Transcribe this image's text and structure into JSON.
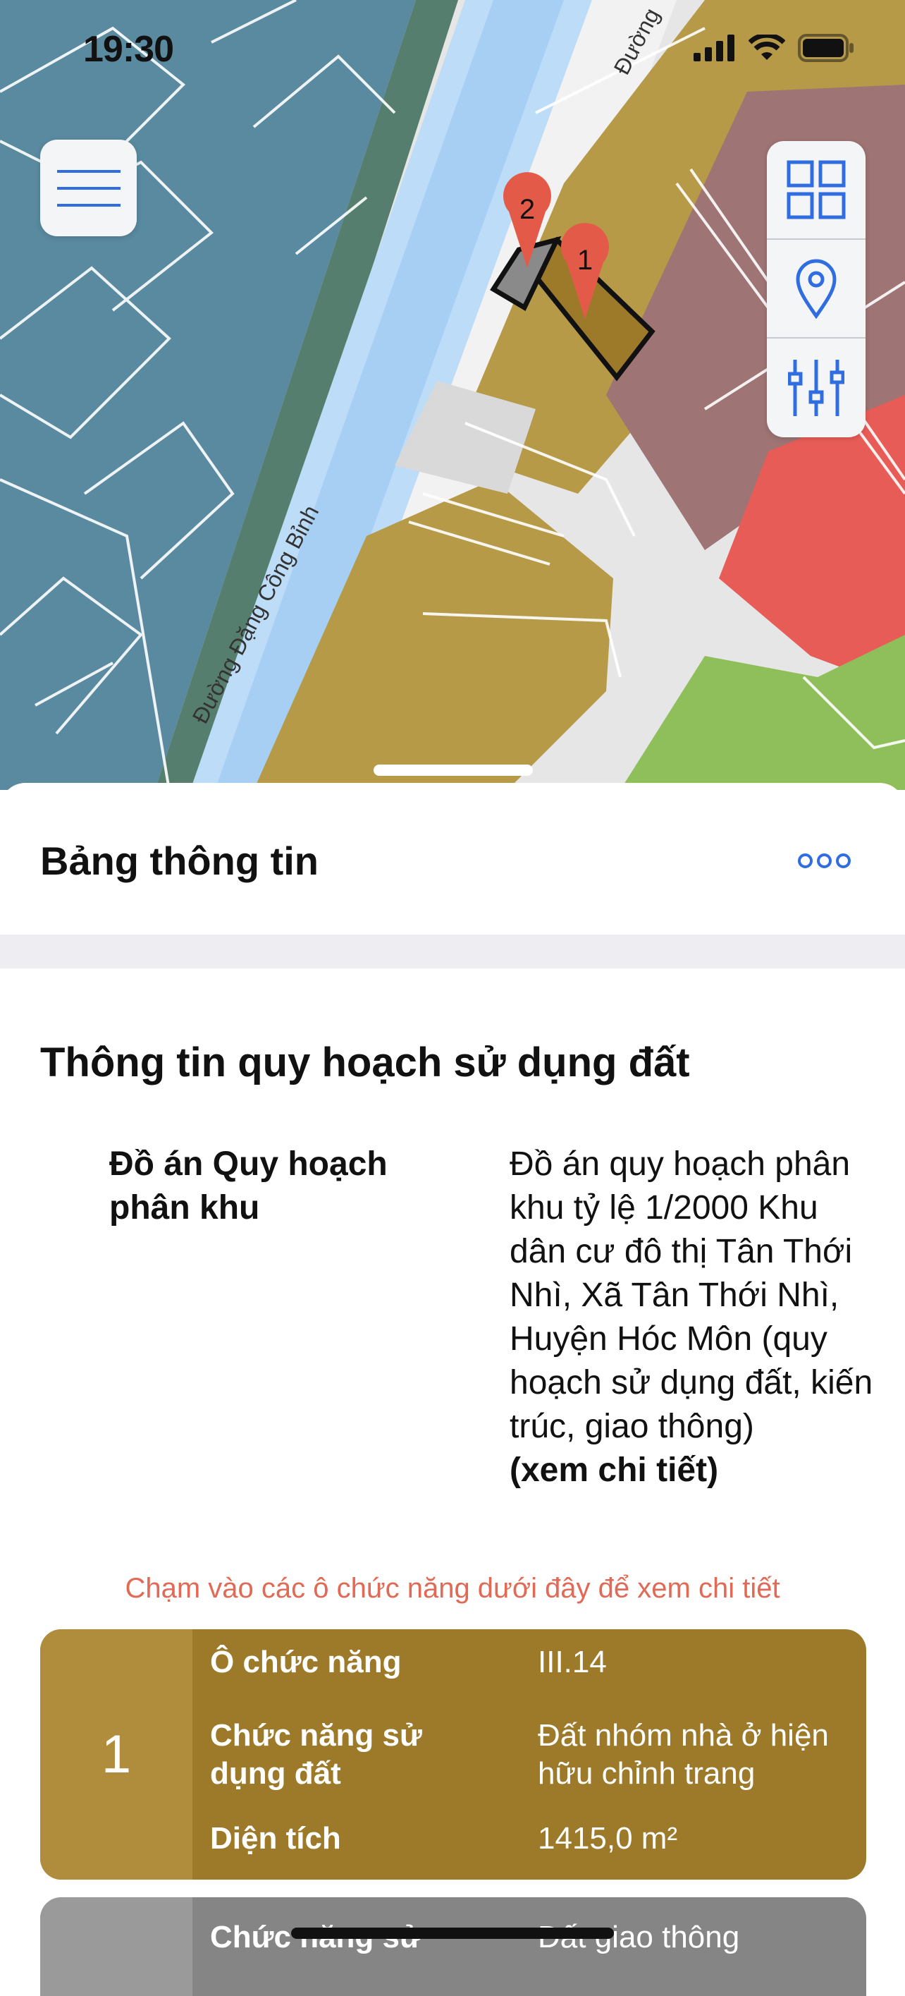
{
  "status_bar": {
    "time": "19:30"
  },
  "map": {
    "roads": [
      "Đường Đặng Công Bỉnh",
      "Đường"
    ],
    "markers": [
      "1",
      "2"
    ],
    "colors": {
      "residential_zone": "#5a8aa0",
      "residential_existing": "#b69a48",
      "selected_parcel": "#9c7a29",
      "commercial": "#e85c57",
      "public": "#9e7474",
      "green": "#8fbf5a",
      "canal": "#bcdcf7"
    }
  },
  "toolbar": {
    "menu_icon": "hamburger-icon",
    "tools": [
      "grid-icon",
      "location-pin-icon",
      "sliders-icon"
    ]
  },
  "sheet": {
    "title": "Bảng thông tin",
    "section_title": "Thông tin quy hoạch sử dụng đất",
    "info_label": "Đồ án Quy hoạch phân khu",
    "info_value": "Đồ án quy hoạch phân khu tỷ lệ 1/2000 Khu dân cư đô thị Tân Thới Nhì, Xã Tân Thới Nhì, Huyện Hóc Môn (quy hoạch sử dụng đất, kiến trúc, giao thông)",
    "info_link": "(xem chi tiết)",
    "hint": "Chạm vào các ô chức năng dưới đây để xem chi tiết",
    "cards": [
      {
        "number": "1",
        "rows": [
          {
            "label": "Ô chức năng",
            "value": "III.14"
          },
          {
            "label": "Chức năng sử dụng đất",
            "value": "Đất nhóm nhà ở hiện hữu chỉnh trang"
          },
          {
            "label": "Diện tích",
            "value": "1415,0 m²"
          }
        ]
      },
      {
        "number": "",
        "rows": [
          {
            "label": "Chức năng sử",
            "value": "Đất giao thông"
          }
        ]
      }
    ]
  }
}
